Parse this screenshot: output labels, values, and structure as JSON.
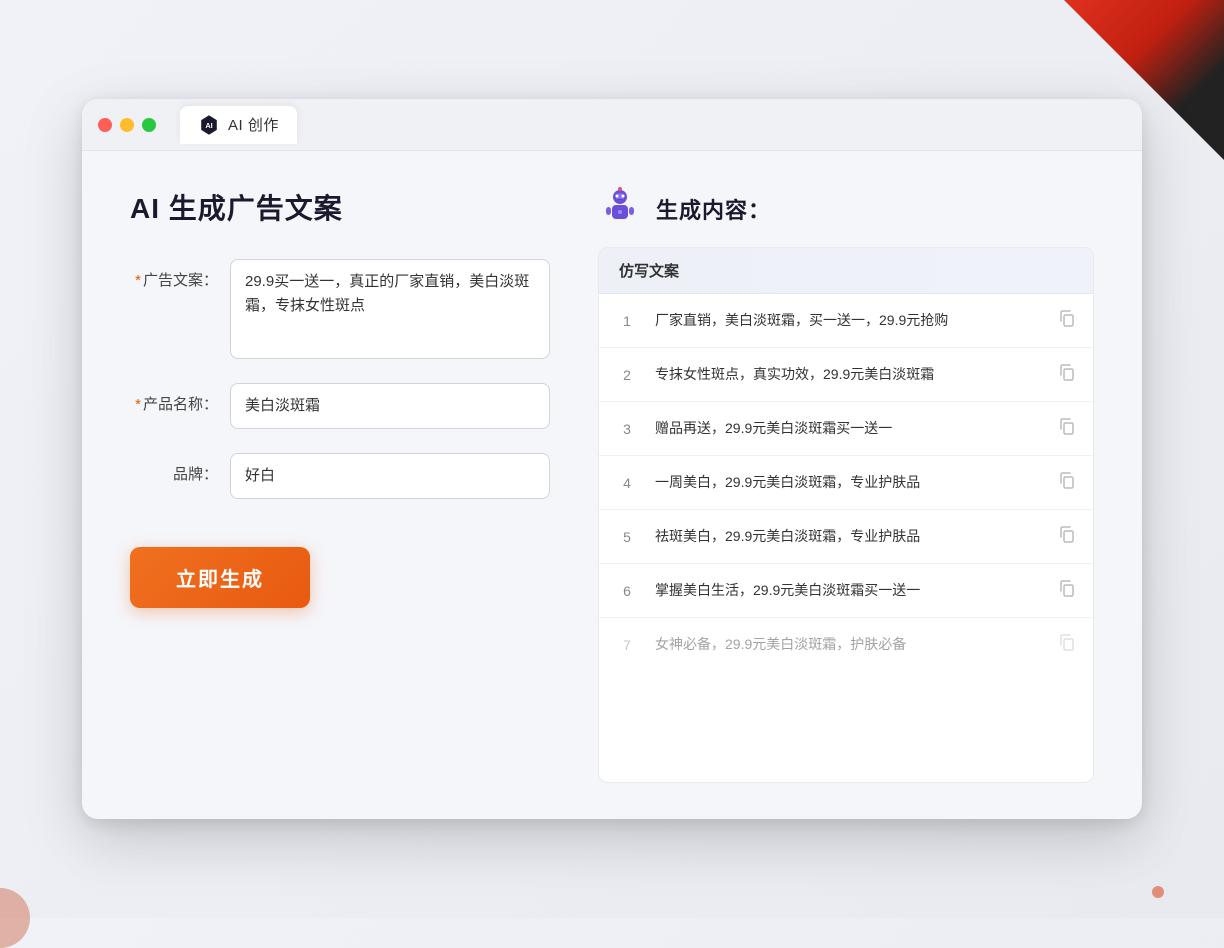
{
  "browser": {
    "tab_label": "AI 创作"
  },
  "page_title": "AI 生成广告文案",
  "form": {
    "ad_copy_label": "广告文案：",
    "ad_copy_value": "29.9买一送一，真正的厂家直销，美白淡斑霜，专抹女性斑点",
    "product_label": "产品名称：",
    "product_value": "美白淡斑霜",
    "brand_label": "品牌：",
    "brand_value": "好白",
    "required_mark": "*",
    "generate_btn": "立即生成"
  },
  "results": {
    "title": "生成内容：",
    "column_header": "仿写文案",
    "items": [
      {
        "num": "1",
        "text": "厂家直销，美白淡斑霜，买一送一，29.9元抢购",
        "faded": false
      },
      {
        "num": "2",
        "text": "专抹女性斑点，真实功效，29.9元美白淡斑霜",
        "faded": false
      },
      {
        "num": "3",
        "text": "赠品再送，29.9元美白淡斑霜买一送一",
        "faded": false
      },
      {
        "num": "4",
        "text": "一周美白，29.9元美白淡斑霜，专业护肤品",
        "faded": false
      },
      {
        "num": "5",
        "text": "祛斑美白，29.9元美白淡斑霜，专业护肤品",
        "faded": false
      },
      {
        "num": "6",
        "text": "掌握美白生活，29.9元美白淡斑霜买一送一",
        "faded": false
      },
      {
        "num": "7",
        "text": "女神必备，29.9元美白淡斑霜，护肤必备",
        "faded": true
      }
    ]
  },
  "colors": {
    "accent": "#f07020",
    "primary": "#5b6ef5",
    "required": "#e05a00"
  }
}
